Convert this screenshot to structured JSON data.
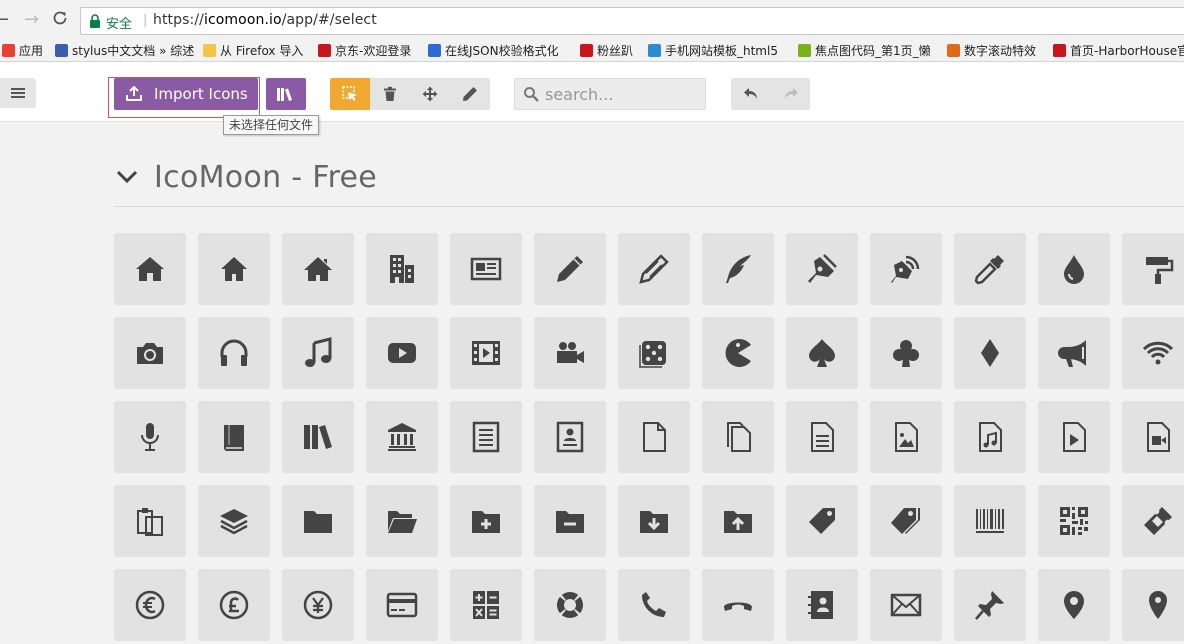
{
  "browser": {
    "secure_label": "安全",
    "url_scheme": "https://",
    "url_host": "icomoon.io",
    "url_path": "/app/#/select"
  },
  "bookmarks": [
    {
      "label": "应用",
      "color": "#e94235"
    },
    {
      "label": "stylus中文文档 » 综述",
      "color": "#3a5fb0"
    },
    {
      "label": "从 Firefox 导入",
      "color": "#f6c343"
    },
    {
      "label": "京东-欢迎登录",
      "color": "#c8161d"
    },
    {
      "label": "在线JSON校验格式化",
      "color": "#2d6bd6"
    },
    {
      "label": "粉丝趴",
      "color": "#c8161d"
    },
    {
      "label": "手机网站模板_html5",
      "color": "#2a8bd6"
    },
    {
      "label": "焦点图代码_第1页_懒",
      "color": "#7ab317"
    },
    {
      "label": "数字滚动特效",
      "color": "#e06a1a"
    },
    {
      "label": "首页-HarborHouse官",
      "color": "#c8161d"
    }
  ],
  "toolbar": {
    "import_label": "Import Icons",
    "tooltip": "未选择任何文件",
    "search_placeholder": "search..."
  },
  "iconset": {
    "title": "IcoMoon - Free"
  },
  "icons": [
    [
      "home",
      "home2",
      "home3",
      "office",
      "newspaper",
      "pencil",
      "pencil2",
      "quill",
      "pen",
      "blog",
      "eyedropper",
      "droplet",
      "paint-format"
    ],
    [
      "camera",
      "headphones",
      "music",
      "play",
      "film",
      "video-camera",
      "dice",
      "pacman",
      "spades",
      "clubs",
      "diamonds",
      "bullhorn",
      "connection"
    ],
    [
      "mic",
      "book",
      "books",
      "library",
      "file-text",
      "profile",
      "file-empty",
      "files-empty",
      "file-text2",
      "file-picture",
      "file-music",
      "file-play",
      "file-video"
    ],
    [
      "copy",
      "stack",
      "folder",
      "folder-open",
      "folder-plus",
      "folder-minus",
      "folder-download",
      "folder-upload",
      "price-tag",
      "price-tags",
      "barcode",
      "qrcode",
      "ticket"
    ],
    [
      "coin-euro",
      "coin-pound",
      "coin-yen",
      "credit-card",
      "calculator",
      "lifebuoy",
      "phone",
      "phone-hang-up",
      "address-book",
      "envelop",
      "pushpin",
      "location",
      "location2"
    ]
  ],
  "colors": {
    "accent": "#8b5aa4",
    "active_mode": "#f0a830",
    "icon": "#444444",
    "tile": "#e2e2e2"
  }
}
